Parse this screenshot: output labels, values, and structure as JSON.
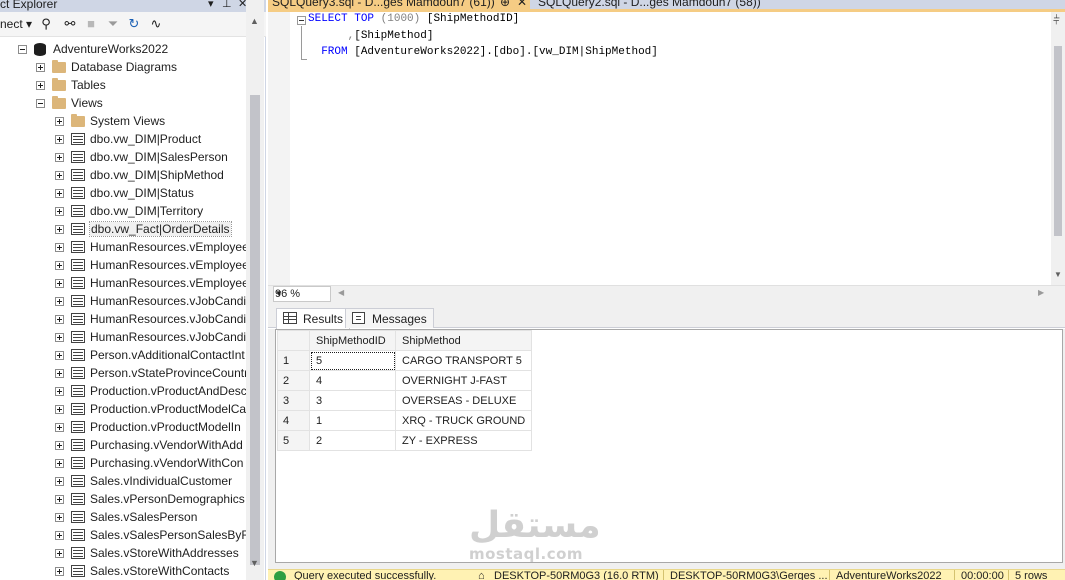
{
  "object_explorer": {
    "title": "ct Explorer",
    "toolbar": {
      "connect_label": "nect ▾"
    },
    "tree": [
      {
        "label": "AdventureWorks2022",
        "icon": "database-icon",
        "expander": "minus",
        "indent": 0
      },
      {
        "label": "Database Diagrams",
        "icon": "folder-icon",
        "expander": "plus",
        "indent": 1
      },
      {
        "label": "Tables",
        "icon": "folder-icon",
        "expander": "plus",
        "indent": 1
      },
      {
        "label": "Views",
        "icon": "folder-icon",
        "expander": "minus",
        "indent": 1
      },
      {
        "label": "System Views",
        "icon": "folder-icon",
        "expander": "plus",
        "indent": 2
      },
      {
        "label": "dbo.vw_DIM|Product",
        "icon": "view-icon",
        "expander": "plus",
        "indent": 2
      },
      {
        "label": "dbo.vw_DIM|SalesPerson",
        "icon": "view-icon",
        "expander": "plus",
        "indent": 2
      },
      {
        "label": "dbo.vw_DIM|ShipMethod",
        "icon": "view-icon",
        "expander": "plus",
        "indent": 2
      },
      {
        "label": "dbo.vw_DIM|Status",
        "icon": "view-icon",
        "expander": "plus",
        "indent": 2
      },
      {
        "label": "dbo.vw_DIM|Territory",
        "icon": "view-icon",
        "expander": "plus",
        "indent": 2
      },
      {
        "label": "dbo.vw_Fact|OrderDetails",
        "icon": "view-icon",
        "expander": "plus",
        "indent": 2,
        "selected": true
      },
      {
        "label": "HumanResources.vEmployee",
        "icon": "view-icon",
        "expander": "plus",
        "indent": 2
      },
      {
        "label": "HumanResources.vEmployee",
        "icon": "view-icon",
        "expander": "plus",
        "indent": 2
      },
      {
        "label": "HumanResources.vEmployee",
        "icon": "view-icon",
        "expander": "plus",
        "indent": 2
      },
      {
        "label": "HumanResources.vJobCandic",
        "icon": "view-icon",
        "expander": "plus",
        "indent": 2
      },
      {
        "label": "HumanResources.vJobCandic",
        "icon": "view-icon",
        "expander": "plus",
        "indent": 2
      },
      {
        "label": "HumanResources.vJobCandic",
        "icon": "view-icon",
        "expander": "plus",
        "indent": 2
      },
      {
        "label": "Person.vAdditionalContactInt",
        "icon": "view-icon",
        "expander": "plus",
        "indent": 2
      },
      {
        "label": "Person.vStateProvinceCountr",
        "icon": "view-icon",
        "expander": "plus",
        "indent": 2
      },
      {
        "label": "Production.vProductAndDesc",
        "icon": "view-icon",
        "expander": "plus",
        "indent": 2
      },
      {
        "label": "Production.vProductModelCa",
        "icon": "view-icon",
        "expander": "plus",
        "indent": 2
      },
      {
        "label": "Production.vProductModelIn",
        "icon": "view-icon",
        "expander": "plus",
        "indent": 2
      },
      {
        "label": "Purchasing.vVendorWithAdd",
        "icon": "view-icon",
        "expander": "plus",
        "indent": 2
      },
      {
        "label": "Purchasing.vVendorWithCon",
        "icon": "view-icon",
        "expander": "plus",
        "indent": 2
      },
      {
        "label": "Sales.vIndividualCustomer",
        "icon": "view-icon",
        "expander": "plus",
        "indent": 2
      },
      {
        "label": "Sales.vPersonDemographics",
        "icon": "view-icon",
        "expander": "plus",
        "indent": 2
      },
      {
        "label": "Sales.vSalesPerson",
        "icon": "view-icon",
        "expander": "plus",
        "indent": 2
      },
      {
        "label": "Sales.vSalesPersonSalesByFisc",
        "icon": "view-icon",
        "expander": "plus",
        "indent": 2
      },
      {
        "label": "Sales.vStoreWithAddresses",
        "icon": "view-icon",
        "expander": "plus",
        "indent": 2
      },
      {
        "label": "Sales.vStoreWithContacts",
        "icon": "view-icon",
        "expander": "plus",
        "indent": 2
      }
    ]
  },
  "tabs": [
    {
      "label": "SQLQuery3.sql - D...ges Mamdouh7 (61))",
      "active": true
    },
    {
      "label": "SQLQuery2.sql - D...ges Mamdouh7 (58))",
      "active": false
    }
  ],
  "editor": {
    "line1": {
      "kw1": "SELECT",
      "kw2": "TOP",
      "num": "(1000)",
      "col": "[ShipMethodID]"
    },
    "line2": {
      "comma": ",",
      "col": "[ShipMethod]"
    },
    "line3": {
      "kw": "FROM",
      "obj": "[AdventureWorks2022].[dbo].[vw_DIM|ShipMethod]"
    }
  },
  "zoom": {
    "value": "96 %"
  },
  "results_tabs": {
    "results": "Results",
    "messages": "Messages"
  },
  "grid": {
    "columns": [
      "ShipMethodID",
      "ShipMethod"
    ],
    "rows": [
      {
        "n": "1",
        "id": "5",
        "name": "CARGO TRANSPORT 5"
      },
      {
        "n": "2",
        "id": "4",
        "name": "OVERNIGHT J-FAST"
      },
      {
        "n": "3",
        "id": "3",
        "name": "OVERSEAS - DELUXE"
      },
      {
        "n": "4",
        "id": "1",
        "name": "XRQ - TRUCK GROUND"
      },
      {
        "n": "5",
        "id": "2",
        "name": "ZY - EXPRESS"
      }
    ]
  },
  "status": {
    "message": "Query executed successfully.",
    "server": "DESKTOP-50RM0G3 (16.0 RTM)",
    "user": "DESKTOP-50RM0G3\\Gerges ...",
    "database": "AdventureWorks2022",
    "time": "00:00:00",
    "rows": "5 rows"
  },
  "watermark": {
    "arabic": "مستقل",
    "latin": "mostaql.com"
  },
  "colors": {
    "tab_active": "#f5cc84",
    "status_bar": "#fff2b3",
    "keyword": "#0000ff",
    "ok": "#2f9e41"
  }
}
